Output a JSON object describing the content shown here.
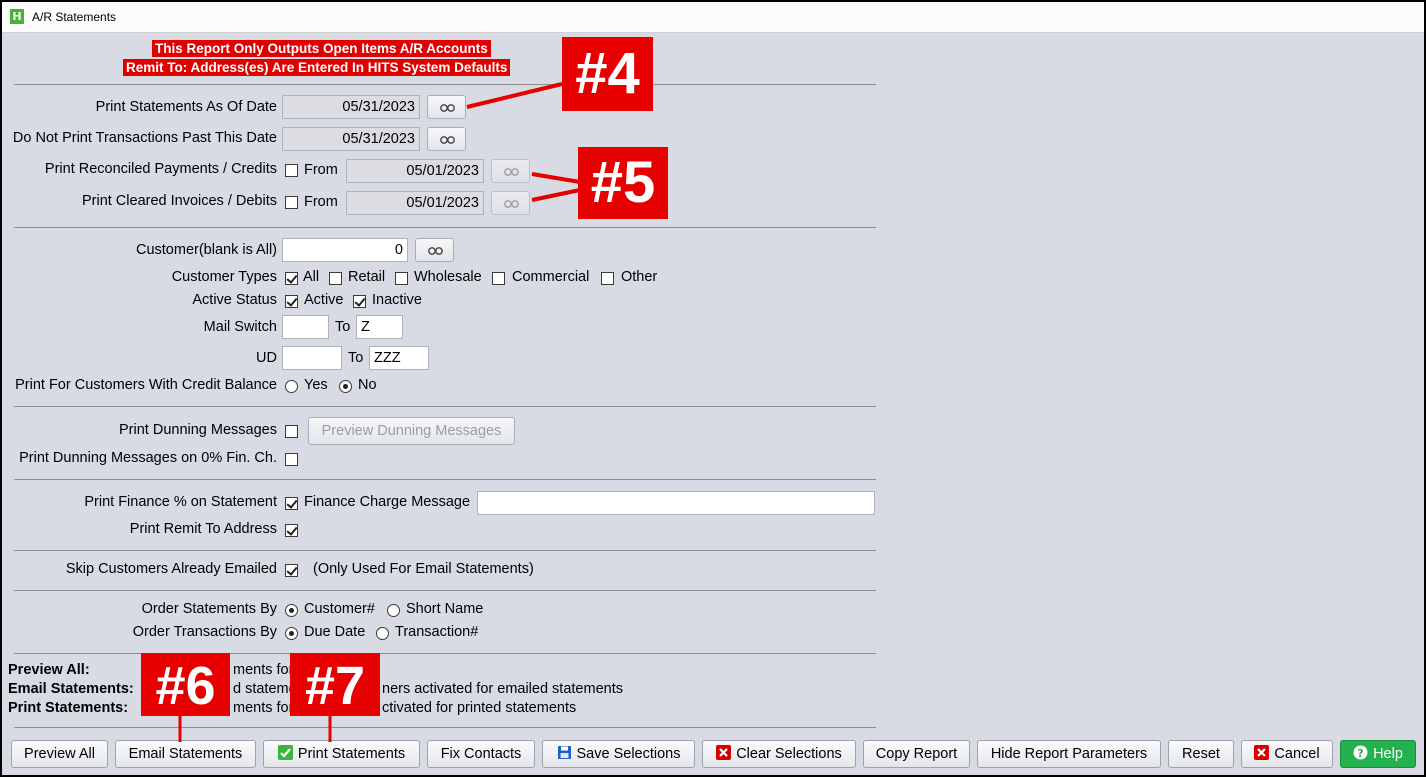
{
  "window": {
    "title": "A/R Statements",
    "app_icon_letter": "H"
  },
  "banners": {
    "line1": "This Report Only Outputs Open Items A/R Accounts",
    "line2": "Remit To: Address(es) Are Entered In HITS System Defaults"
  },
  "dates": {
    "statements_as_of_label": "Print Statements As Of Date",
    "statements_as_of_value": "05/31/2023",
    "do_not_print_past_label": "Do Not Print Transactions Past This Date",
    "do_not_print_past_value": "05/31/2023",
    "reconciled_label": "Print Reconciled Payments / Credits",
    "reconciled_checked": false,
    "reconciled_from_label": "From",
    "reconciled_from_value": "05/01/2023",
    "cleared_label": "Print Cleared Invoices / Debits",
    "cleared_checked": false,
    "cleared_from_label": "From",
    "cleared_from_value": "05/01/2023"
  },
  "customer": {
    "customer_label": "Customer(blank is All)",
    "customer_value": "0",
    "types_label": "Customer Types",
    "types": [
      {
        "label": "All",
        "checked": true
      },
      {
        "label": "Retail",
        "checked": false
      },
      {
        "label": "Wholesale",
        "checked": false
      },
      {
        "label": "Commercial",
        "checked": false
      },
      {
        "label": "Other",
        "checked": false
      }
    ],
    "active_status_label": "Active Status",
    "active_label": "Active",
    "active_checked": true,
    "inactive_label": "Inactive",
    "inactive_checked": true,
    "mail_switch_label": "Mail Switch",
    "mail_switch_from": "",
    "mail_switch_to_label": "To",
    "mail_switch_to": "Z",
    "ud_label": "UD",
    "ud_from": "",
    "ud_to_label": "To",
    "ud_to": "ZZZ",
    "credit_balance_label": "Print For Customers With Credit Balance",
    "credit_yes_label": "Yes",
    "credit_no_label": "No",
    "credit_selected": "No"
  },
  "dunning": {
    "print_dunning_label": "Print Dunning Messages",
    "print_dunning_checked": false,
    "preview_dunning_button": "Preview Dunning Messages",
    "dunning_zero_label": "Print Dunning Messages on 0% Fin. Ch.",
    "dunning_zero_checked": false
  },
  "finance": {
    "print_finance_label": "Print Finance % on Statement",
    "print_finance_checked": true,
    "finance_message_label": "Finance Charge Message",
    "finance_message_value": "",
    "remit_label": "Print Remit To Address",
    "remit_checked": true
  },
  "email": {
    "skip_emailed_label": "Skip Customers Already Emailed",
    "skip_emailed_checked": true,
    "skip_note": "(Only Used For Email Statements)"
  },
  "order": {
    "statements_label": "Order Statements By",
    "statements_opt1": "Customer#",
    "statements_opt2": "Short Name",
    "statements_selected": "Customer#",
    "transactions_label": "Order Transactions By",
    "transactions_opt1": "Due Date",
    "transactions_opt2": "Transaction#",
    "transactions_selected": "Due Date"
  },
  "legend": {
    "preview_key": "Preview All:",
    "preview_text_visible": "ments for a",
    "email_key": "Email Statements:",
    "email_text_a": "d statemer",
    "email_text_b": "ners activated for emailed statements",
    "print_key": "Print Statements:",
    "print_text_a": "ments for c",
    "print_text_b": "ctivated for printed statements"
  },
  "annotations": [
    "#4",
    "#5",
    "#6",
    "#7"
  ],
  "buttons": {
    "preview_all": "Preview All",
    "email_statements": "Email Statements",
    "print_statements": "Print Statements",
    "fix_contacts": "Fix Contacts",
    "save_selections": "Save Selections",
    "clear_selections": "Clear Selections",
    "copy_report": "Copy Report",
    "hide_report_parameters": "Hide Report Parameters",
    "reset": "Reset",
    "cancel": "Cancel",
    "help": "Help"
  },
  "colors": {
    "annotation_red": "#e60000",
    "help_green": "#22b14c",
    "window_bg": "#d8dbe4"
  }
}
